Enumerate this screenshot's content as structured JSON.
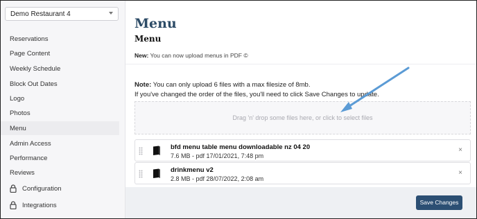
{
  "restaurant_select": {
    "value": "Demo Restaurant 4"
  },
  "sidebar": {
    "items": [
      {
        "label": "Reservations"
      },
      {
        "label": "Page Content"
      },
      {
        "label": "Weekly Schedule"
      },
      {
        "label": "Block Out Dates"
      },
      {
        "label": "Logo"
      },
      {
        "label": "Photos"
      },
      {
        "label": "Menu",
        "active": true
      },
      {
        "label": "Admin Access"
      },
      {
        "label": "Performance"
      },
      {
        "label": "Reviews"
      },
      {
        "label": "Configuration",
        "icon": "lock-icon"
      },
      {
        "label": "Integrations",
        "icon": "lock-icon"
      }
    ]
  },
  "main": {
    "title": "Menu",
    "subtitle": "Menu",
    "new_label": "New:",
    "new_text": " You can now upload menus in PDF ©",
    "note_label": "Note:",
    "note_text": " You can only upload 6 files with a max filesize of 8mb.",
    "note_line2": "If you've changed the order of the files, you'll need to click Save Changes to update.",
    "dropzone_text": "Drag 'n' drop some files here, or click to select files",
    "files": [
      {
        "name": "bfd menu table menu downloadable nz 04 20",
        "meta": "7.6 MB - pdf 17/01/2021, 7:48 pm"
      },
      {
        "name": "drinkmenu v2",
        "meta": "2.8 MB - pdf 28/07/2022, 2:08 am"
      }
    ],
    "close_glyph": "×",
    "save_label": "Save Changes"
  },
  "colors": {
    "accent": "#2c4f73",
    "title": "#2c4b66",
    "annotation_arrow": "#5b9bd5"
  }
}
